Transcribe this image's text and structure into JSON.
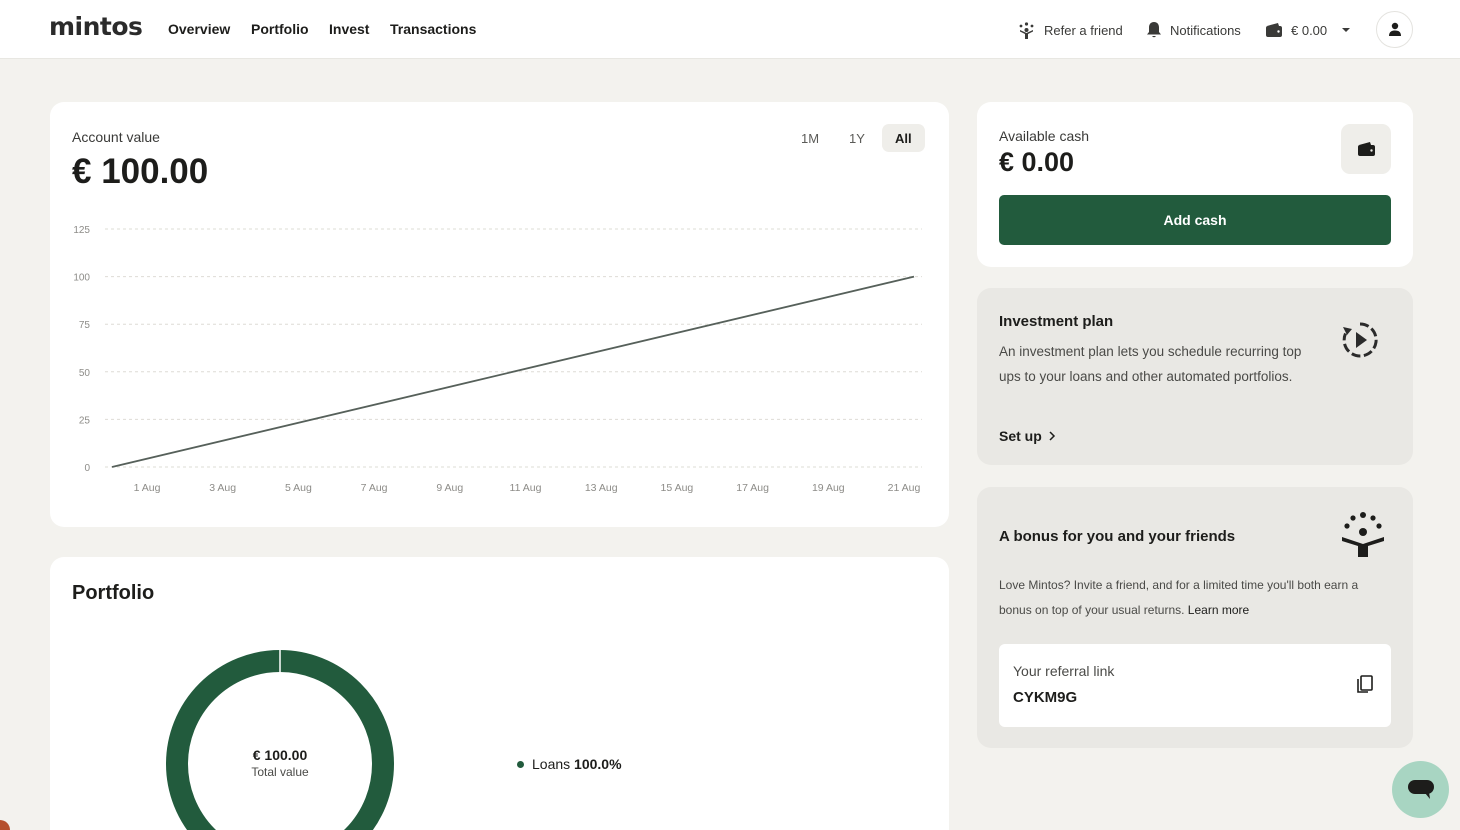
{
  "nav": {
    "logo": "mintos",
    "links": [
      "Overview",
      "Portfolio",
      "Invest",
      "Transactions"
    ],
    "refer": "Refer a friend",
    "notifications": "Notifications",
    "balance": "€ 0.00"
  },
  "account": {
    "label": "Account value",
    "value": "€ 100.00",
    "ranges": [
      "1M",
      "1Y",
      "All"
    ],
    "active_range": "All"
  },
  "chart_data": {
    "type": "line",
    "x_tick_labels": [
      "1 Aug",
      "3 Aug",
      "5 Aug",
      "7 Aug",
      "9 Aug",
      "11 Aug",
      "13 Aug",
      "15 Aug",
      "17 Aug",
      "19 Aug",
      "21 Aug"
    ],
    "y_ticks": [
      0,
      25,
      50,
      75,
      100,
      125
    ],
    "ylim": [
      0,
      125
    ],
    "series": [
      {
        "values": [
          0,
          100
        ]
      }
    ],
    "grid": true,
    "line_color": "#56605a"
  },
  "portfolio": {
    "title": "Portfolio",
    "total_value": "€ 100.00",
    "total_label": "Total value",
    "segments": [
      {
        "label": "Loans",
        "percent": "100.0%",
        "value": 100,
        "color": "#225b3d"
      }
    ]
  },
  "cash": {
    "label": "Available cash",
    "value": "€ 0.00",
    "button": "Add cash"
  },
  "plan": {
    "title": "Investment plan",
    "text": "An investment plan lets you schedule recurring top ups to your loans and other automated portfolios.",
    "link": "Set up"
  },
  "bonus": {
    "title": "A bonus for you and your friends",
    "text": "Love Mintos? Invite a friend, and for a limited time you'll both earn a bonus on top of your usual returns.",
    "learn_more": "Learn more",
    "ref_label": "Your referral link",
    "ref_code": "CYKM9G"
  },
  "colors": {
    "brand": "#225b3d",
    "background": "#f3f2ee",
    "chat": "#a8d5c2"
  }
}
